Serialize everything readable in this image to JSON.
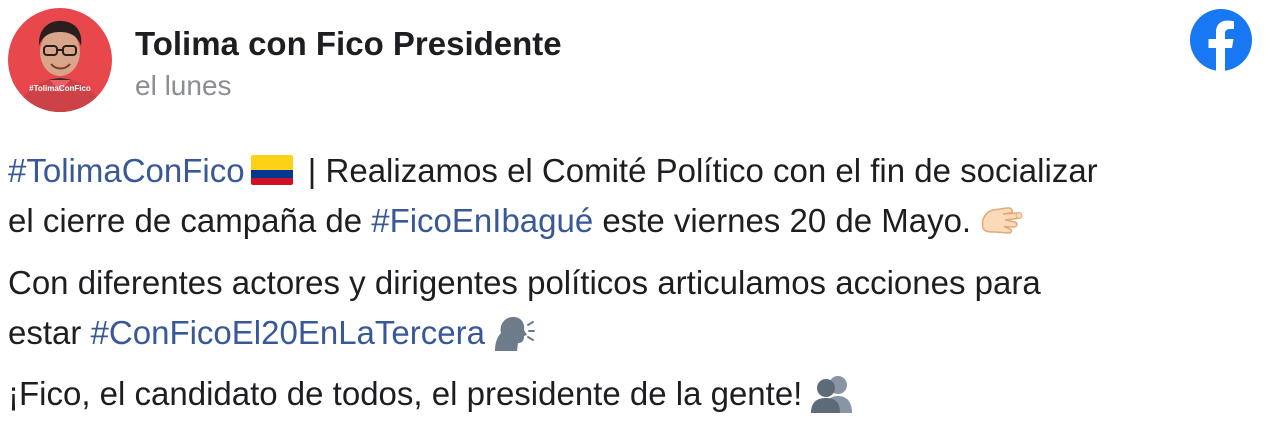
{
  "header": {
    "page_name": "Tolima con Fico Presidente",
    "timestamp": "el lunes",
    "avatar_tag": "#TolimaConFico",
    "logo_icon": "facebook-icon",
    "logo_color": "#1877f2"
  },
  "post": {
    "paragraphs": [
      {
        "line1": {
          "hashtag": "#TolimaConFico",
          "flag_icon": "colombia-flag-icon",
          "text": " | Realizamos el Comité Político con el fin de socializar"
        },
        "line2": {
          "text_before": "el cierre de campaña de ",
          "hashtag": "#FicoEnIbagué",
          "text_after": " este viernes 20 de Mayo.",
          "emoji_icon": "pointing-hand-icon"
        }
      },
      {
        "line1": {
          "text": "Con diferentes actores y dirigentes políticos articulamos acciones para"
        },
        "line2": {
          "text_before": "estar ",
          "hashtag": "#ConFicoEl20EnLaTercera",
          "emoji_icon": "speaking-head-icon"
        }
      },
      {
        "line1": {
          "text": "¡Fico, el candidato de todos, el presidente de la gente!",
          "emoji_icon": "busts-in-silhouette-icon"
        }
      }
    ]
  },
  "colors": {
    "text": "#1c1e21",
    "secondary_text": "#8a8d91",
    "hashtag": "#385898",
    "avatar_bg": "#e8474c"
  }
}
